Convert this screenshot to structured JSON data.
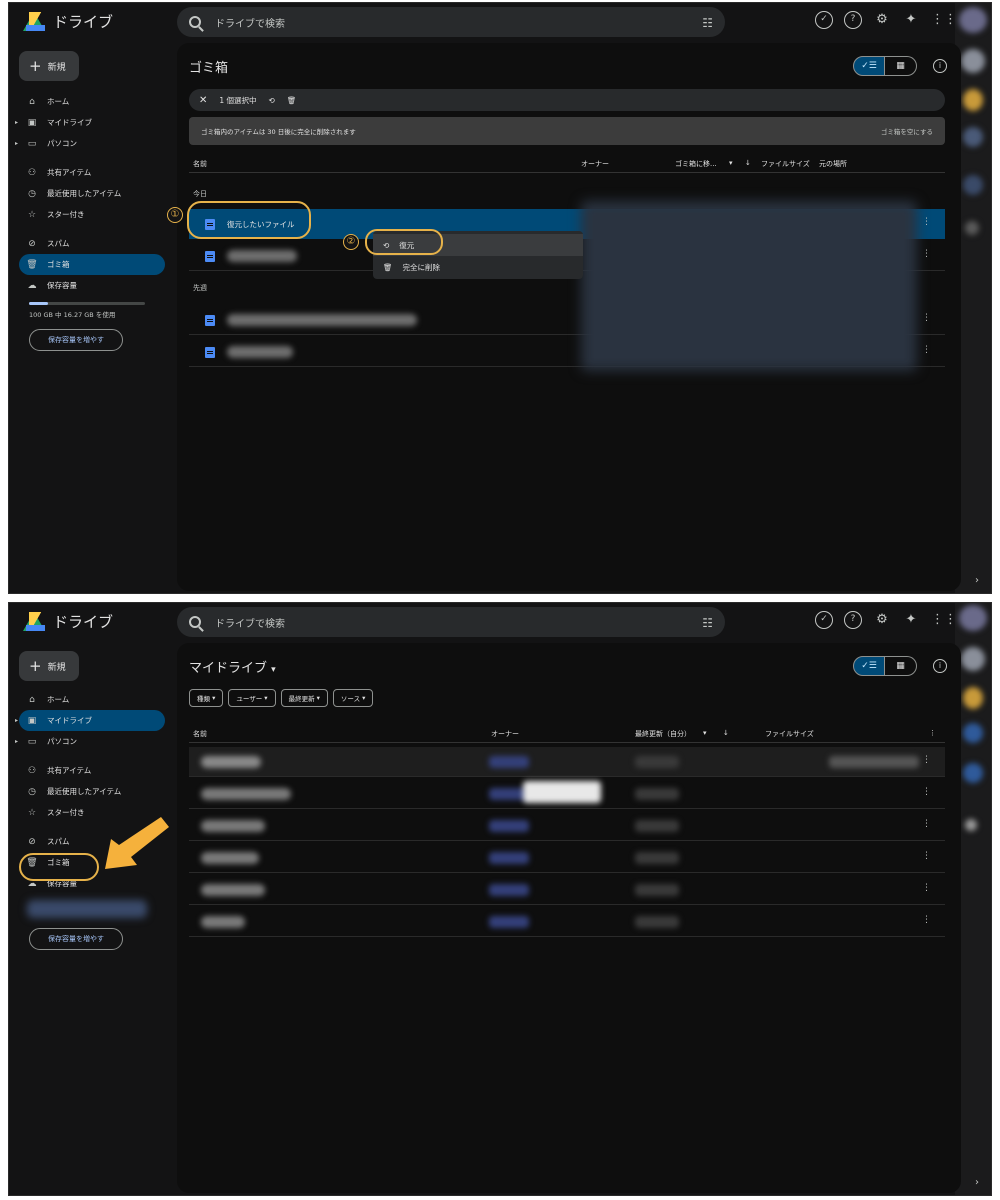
{
  "common": {
    "app_name": "ドライブ",
    "search_placeholder": "ドライブで検索",
    "new_label": "新規",
    "nav": {
      "home": "ホーム",
      "my_drive": "マイドライブ",
      "computers": "パソコン",
      "shared": "共有アイテム",
      "recent": "最近使用したアイテム",
      "starred": "スター付き",
      "spam": "スパム",
      "trash": "ゴミ箱",
      "storage": "保存容量"
    },
    "storage_usage": "100 GB 中 16.27 GB を使用",
    "storage_fraction": 0.16,
    "get_more_storage": "保存容量を増やす",
    "icons": [
      "search-icon",
      "tune-icon",
      "offline-icon",
      "help-icon",
      "settings-icon",
      "gemini-icon",
      "apps-icon"
    ],
    "accent_color": "#004a77",
    "callout_color": "#e6b24a"
  },
  "trash_view": {
    "title": "ゴミ箱",
    "selection_text": "1 個選択中",
    "notice": "ゴミ箱内のアイテムは 30 日後に完全に削除されます",
    "empty_trash": "ゴミ箱を空にする",
    "columns": {
      "name": "名前",
      "owner": "オーナー",
      "trashed": "ゴミ箱に移...",
      "file_size": "ファイルサイズ",
      "location": "元の場所"
    },
    "section_today": "今日",
    "section_last_week": "先週",
    "selected_file": "復元したいファイル",
    "context_menu": {
      "restore": "復元",
      "delete_forever": "完全に削除"
    },
    "step1": "①",
    "step2": "②"
  },
  "mydrive_view": {
    "title": "マイドライブ",
    "filters": [
      "種類",
      "ユーザー",
      "最終更新",
      "ソース"
    ],
    "columns": {
      "name": "名前",
      "owner": "オーナー",
      "modified": "最終更新（自分）",
      "file_size": "ファイルサイズ"
    }
  }
}
